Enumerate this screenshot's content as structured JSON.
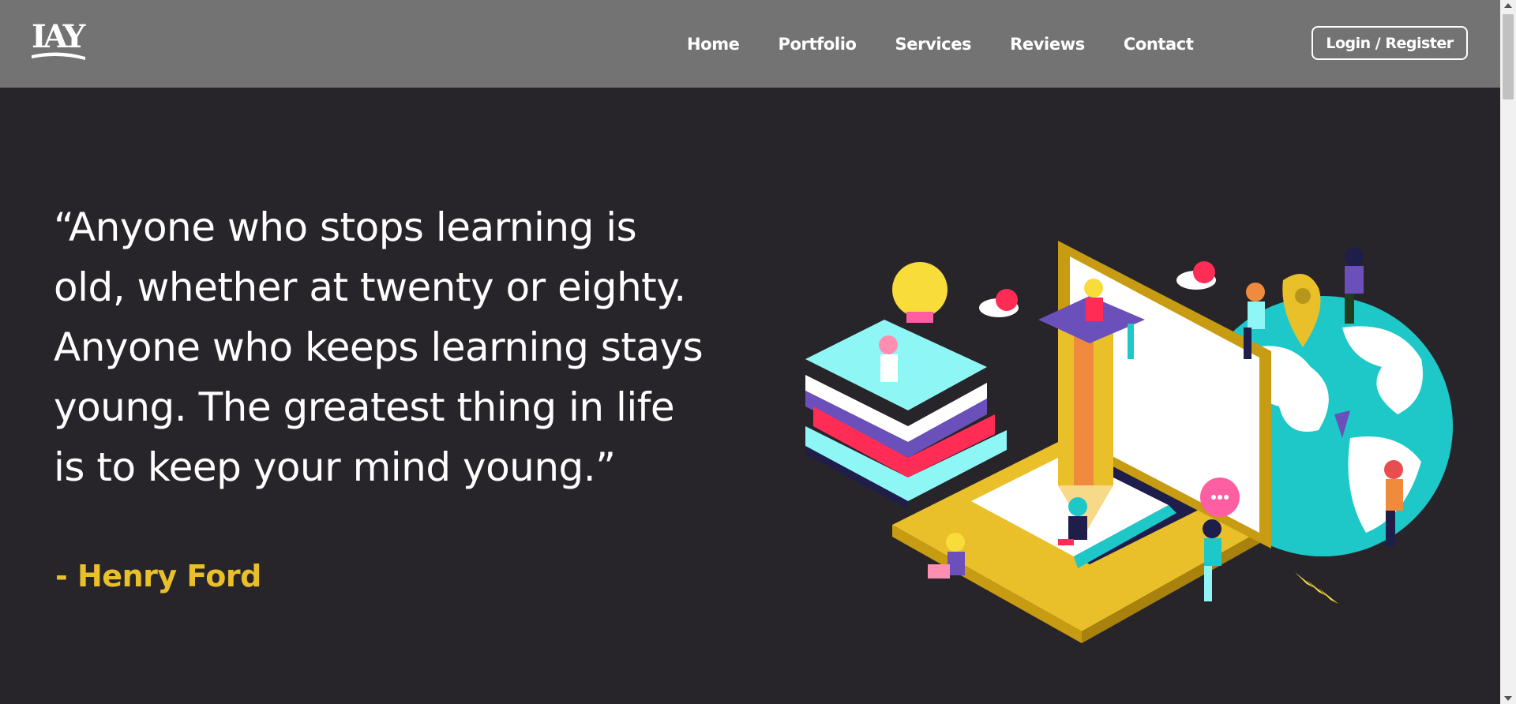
{
  "nav": {
    "logo_text": "IAY",
    "links": [
      "Home",
      "Portfolio",
      "Services",
      "Reviews",
      "Contact"
    ],
    "login_label": "Login / Register"
  },
  "hero": {
    "quote": "“Anyone who stops learning is old, whether at twenty or eighty. Anyone who keeps learning stays young. The greatest thing in life is to keep your mind young.”",
    "author": "- Henry Ford",
    "illustration_icon": "isometric-learning-illustration"
  },
  "colors": {
    "navbar_bg": "#737373",
    "page_bg": "#27252a",
    "text": "#ffffff",
    "accent": "#e9c02a"
  }
}
